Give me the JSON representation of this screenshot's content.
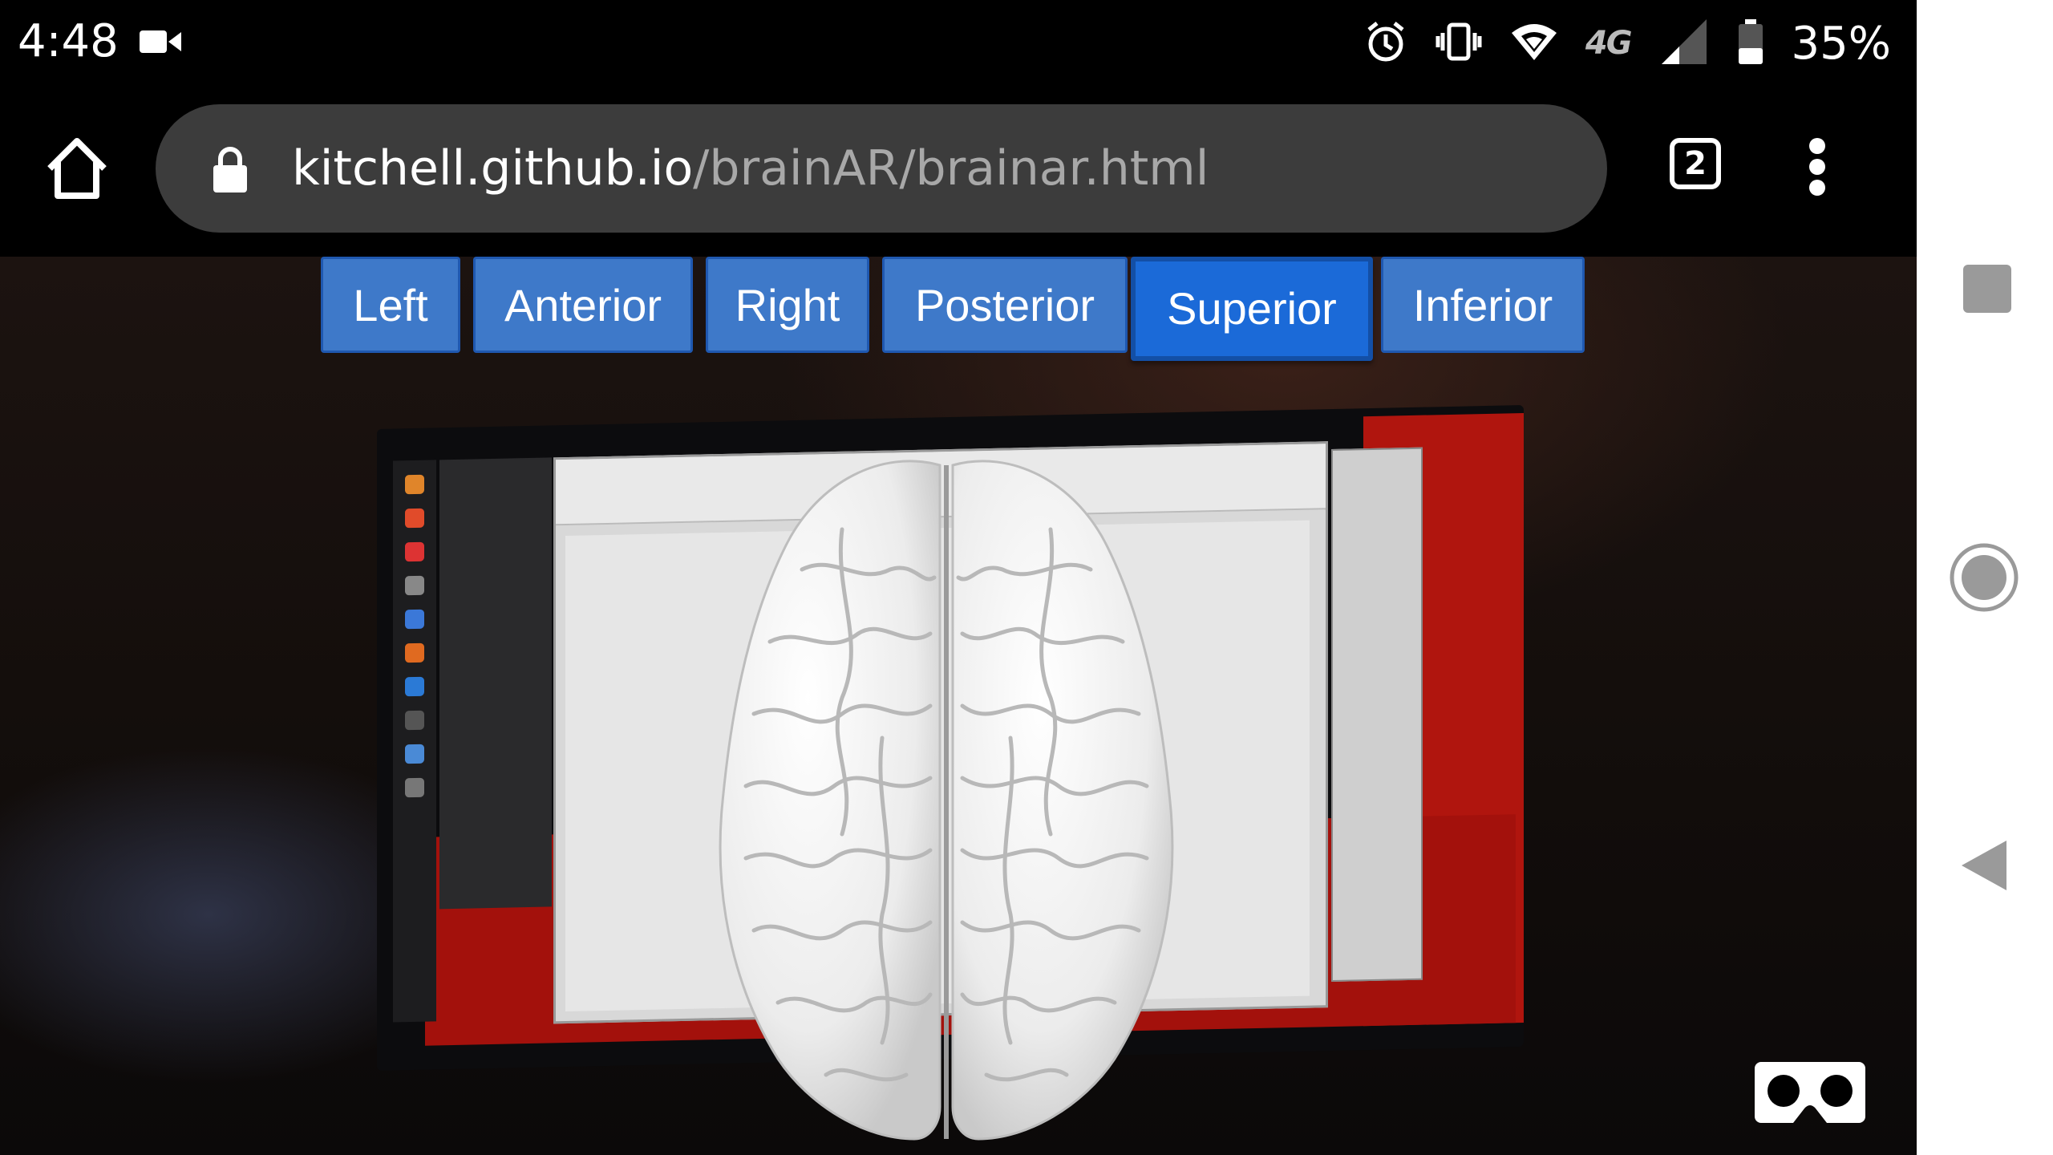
{
  "status_bar": {
    "time": "4:48",
    "left_icons": [
      "video-camera-icon"
    ],
    "right_icons": [
      "alarm-icon",
      "vibrate-icon",
      "wifi-icon",
      "network-icon",
      "signal-icon",
      "battery-icon"
    ],
    "network": "4G",
    "battery": "35%"
  },
  "browser": {
    "url_host": "kitchell.github.io",
    "url_path": "/brainAR/brainar.html",
    "tab_count": "2"
  },
  "view_buttons": [
    {
      "label": "Left",
      "active": false
    },
    {
      "label": "Anterior",
      "active": false
    },
    {
      "label": "Right",
      "active": false
    },
    {
      "label": "Posterior",
      "active": false
    },
    {
      "label": "Superior",
      "active": true
    },
    {
      "label": "Inferior",
      "active": false
    }
  ],
  "colors": {
    "button_bg": "#3e79c9",
    "button_active_bg": "#1b6ad8",
    "urlbar_bg": "#3c3c3c",
    "brain": "#f2f2f2"
  }
}
